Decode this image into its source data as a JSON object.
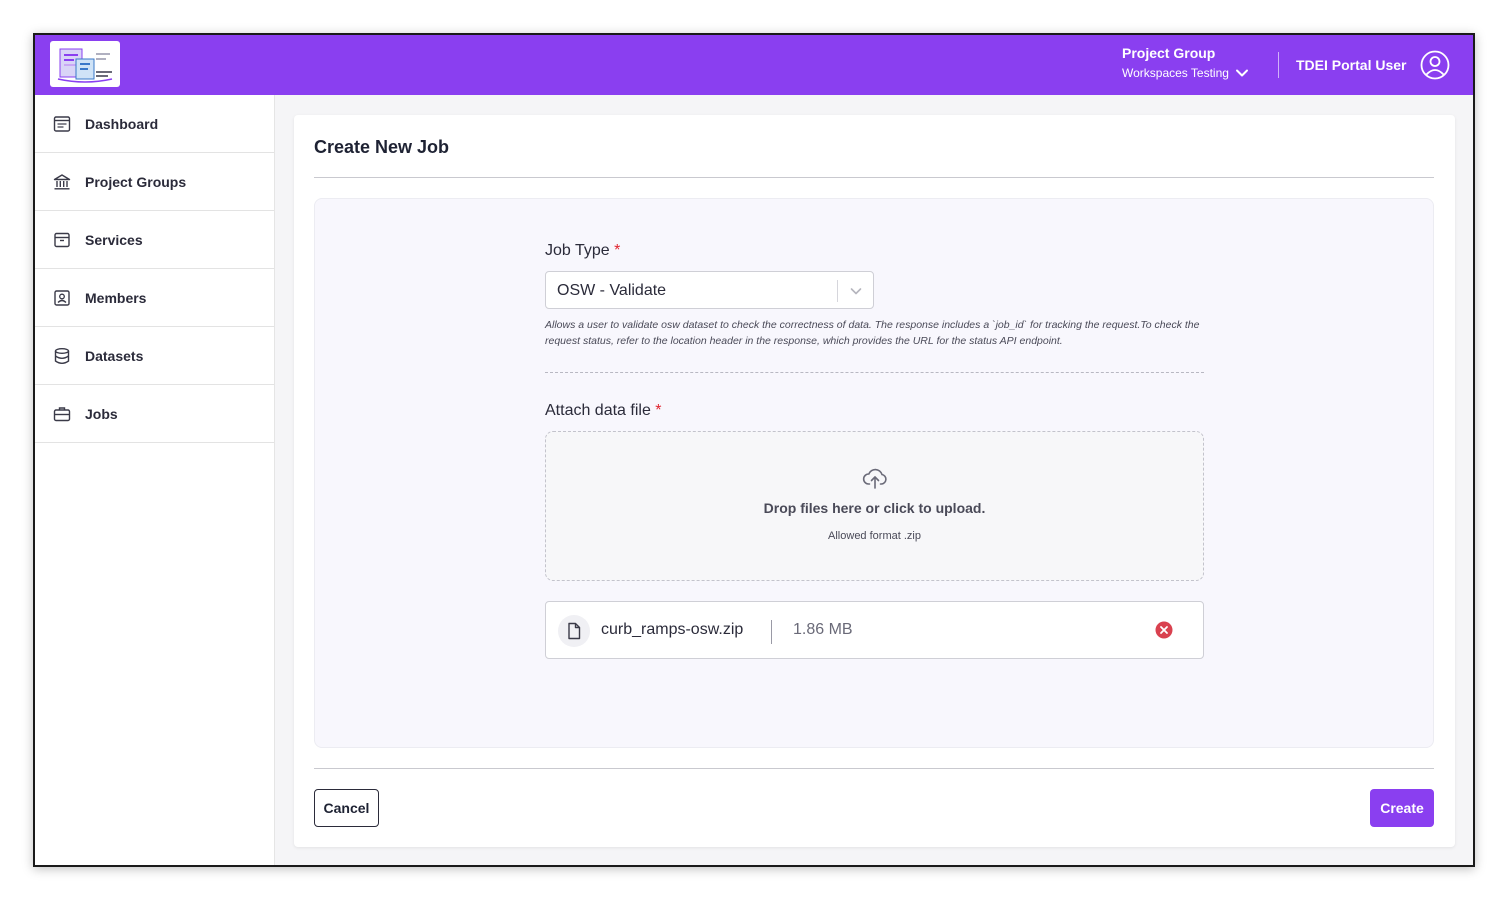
{
  "header": {
    "project_group_label": "Project Group",
    "project_group_value": "Workspaces Testing",
    "user_name": "TDEI Portal User",
    "brand_color": "#8a3ff0"
  },
  "sidebar": {
    "items": [
      {
        "label": "Dashboard",
        "icon": "dashboard-icon"
      },
      {
        "label": "Project Groups",
        "icon": "bank-icon"
      },
      {
        "label": "Services",
        "icon": "archive-box-icon"
      },
      {
        "label": "Members",
        "icon": "id-badge-icon"
      },
      {
        "label": "Datasets",
        "icon": "database-icon"
      },
      {
        "label": "Jobs",
        "icon": "briefcase-icon"
      }
    ]
  },
  "main": {
    "title": "Create New Job",
    "job_type": {
      "label": "Job Type",
      "required_mark": "*",
      "selected": "OSW - Validate",
      "description": "Allows a user to validate osw dataset to check the correctness of data. The response includes a `job_id` for tracking the request.To check the request status, refer to the location header in the response, which provides the URL for the status API endpoint."
    },
    "attach": {
      "label": "Attach data file",
      "required_mark": "*",
      "dropzone_text": "Drop files here or click to upload.",
      "allowed_format": "Allowed format .zip"
    },
    "file": {
      "name": "curb_ramps-osw.zip",
      "size": "1.86 MB"
    },
    "buttons": {
      "cancel": "Cancel",
      "create": "Create"
    }
  }
}
